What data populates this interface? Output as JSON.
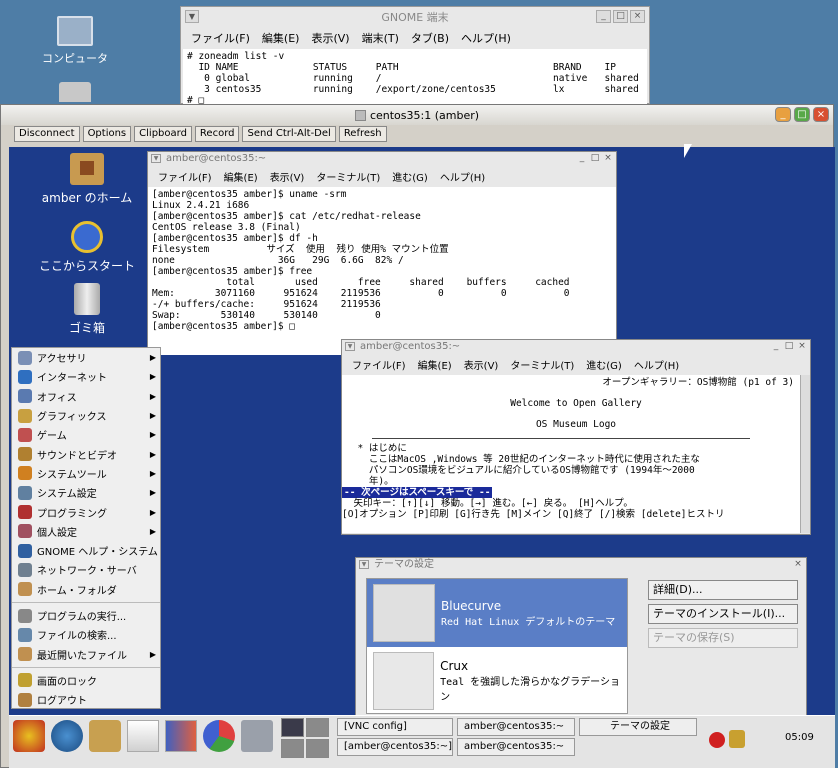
{
  "desktop_icons": [
    {
      "label": "コンピュータ",
      "icon": "computer-icon"
    },
    {
      "label": "",
      "icon": "home-folder-icon"
    }
  ],
  "gnome_terminal": {
    "title": "GNOME 端末",
    "menu": [
      "ファイル(F)",
      "編集(E)",
      "表示(V)",
      "端末(T)",
      "タブ(B)",
      "ヘルプ(H)"
    ],
    "text": "# zoneadm list -v\n  ID NAME             STATUS     PATH                           BRAND    IP\n   0 global           running    /                              native   shared\n   3 centos35         running    /export/zone/centos35          lx       shared\n# □"
  },
  "vnc": {
    "title": "centos35:1 (amber)",
    "toolbar": [
      "Disconnect",
      "Options",
      "Clipboard",
      "Record",
      "Send Ctrl-Alt-Del",
      "Refresh"
    ]
  },
  "screen_icons": [
    {
      "label": "amber のホーム",
      "icon": "home-icon"
    },
    {
      "label": "ここからスタート",
      "icon": "start-here-icon"
    },
    {
      "label": "ゴミ箱",
      "icon": "trash-icon"
    }
  ],
  "term1": {
    "title": "amber@centos35:~",
    "menu": [
      "ファイル(F)",
      "編集(E)",
      "表示(V)",
      "ターミナル(T)",
      "進む(G)",
      "ヘルプ(H)"
    ],
    "text": "[amber@centos35 amber]$ uname -srm\nLinux 2.4.21 i686\n[amber@centos35 amber]$ cat /etc/redhat-release\nCentOS release 3.8 (Final)\n[amber@centos35 amber]$ df -h\nFilesystem          サイズ  使用  残り 使用% マウント位置\nnone                  36G   29G  6.6G  82% /\n[amber@centos35 amber]$ free\n             total       used       free     shared    buffers     cached\nMem:       3071160     951624    2119536          0          0          0\n-/+ buffers/cache:     951624    2119536\nSwap:       530140     530140          0\n[amber@centos35 amber]$ □"
  },
  "term2": {
    "title": "amber@centos35:~",
    "menu": [
      "ファイル(F)",
      "編集(E)",
      "表示(V)",
      "ターミナル(T)",
      "進む(G)",
      "ヘルプ(H)"
    ],
    "header": "オープンギャラリー：OS博物館 (p1 of 3)",
    "welcome": "Welcome to Open Gallery",
    "logo": "OS Museum Logo",
    "body": "  * はじめに\n    ここはMacOS ,Windows 等 20世紀のインターネット時代に使用された主な\n    パソコンOS環境をビジュアルに紹介しているOS博物館です (1994年～2000\n    年)。",
    "status": "-- 次ページはスペースキーで --",
    "help1": "  矢印キー：[↑][↓] 移動。[→] 進む。[←] 戻る。 [H]ヘルプ。",
    "help2": "[O]オプション [P]印刷 [G]行き先 [M]メイン [Q]終了 [/]検索 [delete]ヒストリ"
  },
  "start_menu": {
    "items": [
      {
        "label": "アクセサリ",
        "arrow": true,
        "color": "#7a8fb5"
      },
      {
        "label": "インターネット",
        "arrow": true,
        "color": "#2f6fc0"
      },
      {
        "label": "オフィス",
        "arrow": true,
        "color": "#5a7ab0"
      },
      {
        "label": "グラフィックス",
        "arrow": true,
        "color": "#c8a040"
      },
      {
        "label": "ゲーム",
        "arrow": true,
        "color": "#c05050"
      },
      {
        "label": "サウンドとビデオ",
        "arrow": true,
        "color": "#b08030"
      },
      {
        "label": "システムツール",
        "arrow": true,
        "color": "#d08020"
      },
      {
        "label": "システム設定",
        "arrow": true,
        "color": "#6080a0"
      },
      {
        "label": "プログラミング",
        "arrow": true,
        "color": "#b03030"
      },
      {
        "label": "個人設定",
        "arrow": true,
        "color": "#a05060"
      },
      {
        "label": "GNOME ヘルプ・システム",
        "arrow": false,
        "color": "#3060a0"
      },
      {
        "label": "ネットワーク・サーバ",
        "arrow": false,
        "color": "#708090"
      },
      {
        "label": "ホーム・フォルダ",
        "arrow": false,
        "color": "#c09050"
      }
    ],
    "items2": [
      {
        "label": "プログラムの実行...",
        "color": "#888888"
      },
      {
        "label": "ファイルの検索...",
        "color": "#6688aa"
      },
      {
        "label": "最近開いたファイル",
        "arrow": true,
        "color": "#c09050"
      }
    ],
    "items3": [
      {
        "label": "画面のロック",
        "color": "#c0a030"
      },
      {
        "label": "ログアウト",
        "color": "#b08040"
      }
    ]
  },
  "theme_dialog": {
    "title": "テーマの設定",
    "themes": [
      {
        "name": "Bluecurve",
        "desc": "Red Hat Linux デフォルトのテーマ"
      },
      {
        "name": "Crux",
        "desc": "Teal を強調した滑らかなグラデーション"
      }
    ],
    "buttons": [
      "詳細(D)...",
      "テーマのインストール(I)...",
      "テーマの保存(S)"
    ]
  },
  "panel": {
    "tasks": [
      "[VNC config]",
      "amber@centos35:~",
      "テーマの設定",
      "[amber@centos35:~]",
      "amber@centos35:~"
    ],
    "clock": "05:09"
  }
}
